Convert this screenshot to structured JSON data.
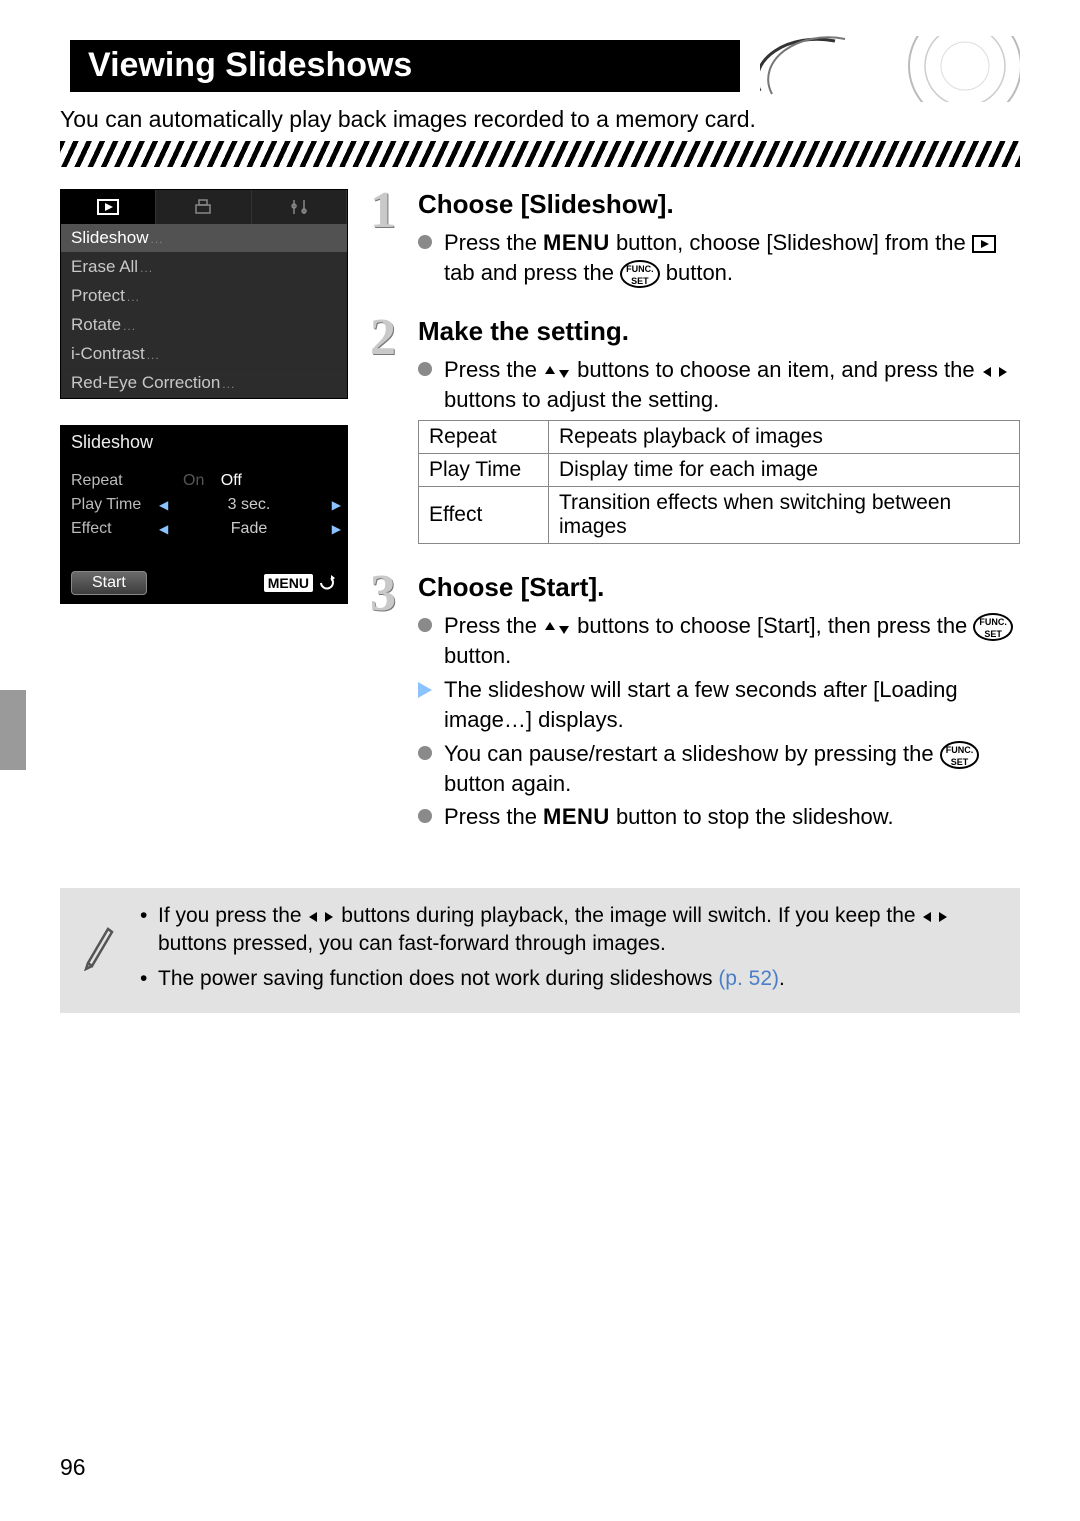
{
  "page_title": "Viewing Slideshows",
  "intro": "You can automatically play back images recorded to a memory card.",
  "page_number": "96",
  "lcd1": {
    "items": [
      "Slideshow",
      "Erase All",
      "Protect",
      "Rotate",
      "i-Contrast",
      "Red-Eye Correction"
    ]
  },
  "lcd2": {
    "title": "Slideshow",
    "rows": [
      {
        "label": "Repeat",
        "on": "On",
        "off": "Off"
      },
      {
        "label": "Play Time",
        "value": "3 sec."
      },
      {
        "label": "Effect",
        "value": "Fade"
      }
    ],
    "start": "Start",
    "menu": "MENU"
  },
  "steps": [
    {
      "num": "1",
      "title": "Choose [Slideshow].",
      "b1a": "Press the ",
      "b1b": " button, choose [Slideshow] from the ",
      "b1c": " tab and press the ",
      "b1d": " button."
    },
    {
      "num": "2",
      "title": "Make the setting.",
      "b1a": "Press the ",
      "b1b": " buttons to choose an item, and press the ",
      "b1c": " buttons to adjust the setting.",
      "table": [
        {
          "k": "Repeat",
          "v": "Repeats playback of images"
        },
        {
          "k": "Play Time",
          "v": "Display time for each image"
        },
        {
          "k": "Effect",
          "v": "Transition effects when switching between images"
        }
      ]
    },
    {
      "num": "3",
      "title": "Choose [Start].",
      "lines": {
        "l1a": "Press the ",
        "l1b": " buttons to choose [Start], then press the ",
        "l1c": " button.",
        "l2": "The slideshow will start a few seconds after [Loading image…] displays.",
        "l3a": "You can pause/restart a slideshow by pressing the ",
        "l3b": " button again.",
        "l4a": "Press the ",
        "l4b": " button to stop the slideshow."
      }
    }
  ],
  "note": {
    "n1a": "If you press the ",
    "n1b": " buttons during playback, the image will switch. If you keep the ",
    "n1c": " buttons pressed, you can fast-forward through images.",
    "n2a": "The power saving function does not work during slideshows ",
    "n2b": "(p. 52)",
    "n2c": "."
  },
  "labels": {
    "menu_word": "MENU",
    "func": "FUNC.",
    "set": "SET"
  }
}
